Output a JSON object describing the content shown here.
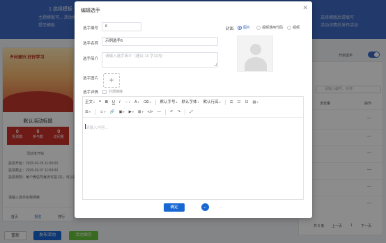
{
  "background": {
    "banner_title": "1.选择模板",
    "banner_line1": "主题模板可... 活动模板可...",
    "banner_line2": "提交模板",
    "banner_right1": "选择模版后请填写",
    "banner_right2": "活动详情后发布活动",
    "poster_text": "乡村振兴 好好学习",
    "phone_title": "默认活动标题",
    "stats": [
      {
        "value": "0",
        "label": "投票数"
      },
      {
        "value": "0",
        "label": "参与数"
      },
      {
        "value": "0",
        "label": "访问量"
      }
    ],
    "activity_start": "活动未开始",
    "line_start": "投票开始：2025-02-25 11:00:00",
    "line_end": "投票截止：2025-03-07 11:00:00",
    "line_rule": "投票规则：每个微信号每天可投1次，可以投...",
    "phone_search": "请输入选手名称搜索",
    "phone_nav": [
      "首页",
      "报名",
      "排行"
    ],
    "buttons": {
      "reset": "重新",
      "publish": "发布活动",
      "save": "活动保存"
    },
    "toggle_label": "开启选手",
    "table_search_placeholder": "请输入编号、名称",
    "table_headers": [
      "浏览量",
      "操作"
    ],
    "table_dash": "—",
    "pager": {
      "total": "共 6 条",
      "prev": "上一页",
      "page": "1",
      "next": "下一页"
    },
    "colors": {
      "primary": "#1967d2",
      "banner": "#3d6bc4",
      "success": "#67c23a"
    }
  },
  "dialog": {
    "title": "编辑选手",
    "close_icon": "close-icon",
    "fields": {
      "number_label": "选手编号",
      "number_value": "6",
      "name_label": "选手名称",
      "name_value": "示例选手6",
      "intro_label": "选手简介",
      "intro_placeholder": "请输入选手简介（建议 16 字以内）",
      "image_label": "选手图片",
      "detail_label": "选手详情",
      "external_link_label": "外部链接"
    },
    "media_select": {
      "label": "封面:",
      "options": [
        "图片",
        "视频通用代码",
        "视频"
      ],
      "selected": "图片"
    },
    "toolbar_row1": [
      "正文",
      "❝",
      "B",
      "U",
      "I",
      "···",
      "A",
      "⌫",
      "默认字号",
      "默认字体",
      "默认行高",
      "☰",
      "☷",
      "☑",
      "▤"
    ],
    "toolbar_row2": [
      "☰",
      "☺",
      "🔗",
      "▣",
      "▶",
      "⊞",
      "</>",
      "—",
      "↶",
      "↷",
      "⤢"
    ],
    "editor_placeholder": "请输入内容...",
    "confirm_label": "确定"
  }
}
